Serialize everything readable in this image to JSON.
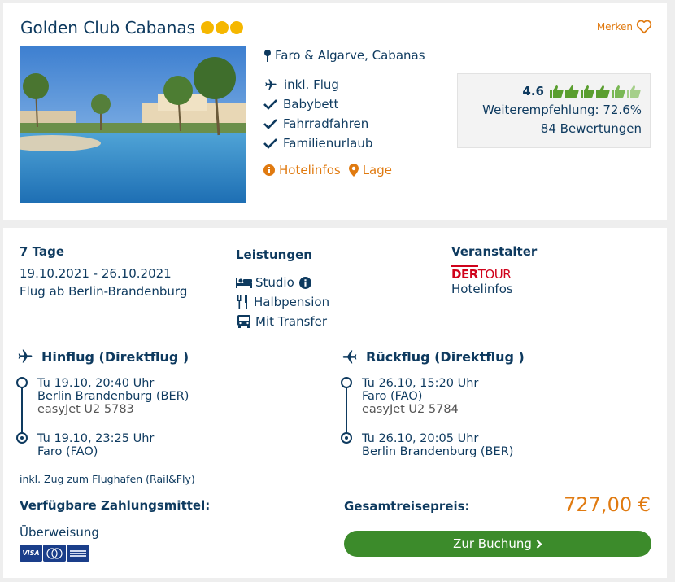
{
  "hotel": {
    "name": "Golden Club Cabanas",
    "stars": 3,
    "location": "Faro & Algarve, Cabanas",
    "features": [
      {
        "icon": "plane-icon",
        "label": "inkl. Flug"
      },
      {
        "icon": "check-icon",
        "label": "Babybett"
      },
      {
        "icon": "check-icon",
        "label": "Fahrradfahren"
      },
      {
        "icon": "check-icon",
        "label": "Familienurlaub"
      }
    ],
    "links": {
      "hotelinfos": "Hotelinfos",
      "lage": "Lage"
    }
  },
  "merken": {
    "label": "Merken",
    "icon": "heart-icon"
  },
  "rating": {
    "score": "4.6",
    "thumbs_out_of_6": 4.6,
    "recommendation": "Weiterempfehlung: 72.6%",
    "reviews": "84 Bewertungen"
  },
  "trip": {
    "duration": "7 Tage",
    "dates": "19.10.2021 - 26.10.2021",
    "departure": "Flug ab Berlin-Brandenburg"
  },
  "services": {
    "title": "Leistungen",
    "items": [
      {
        "icon": "bed-icon",
        "label": "Studio",
        "info": true
      },
      {
        "icon": "cutlery-icon",
        "label": "Halbpension"
      },
      {
        "icon": "bus-icon",
        "label": "Mit Transfer"
      }
    ]
  },
  "operator": {
    "title": "Veranstalter",
    "logo_der": "DER",
    "logo_tour": "TOUR",
    "link": "Hotelinfos"
  },
  "outbound": {
    "title": "Hinflug (Direktflug )",
    "dep_time": "Tu 19.10, 20:40 Uhr",
    "dep_airport": "Berlin Brandenburg (BER)",
    "carrier": "easyJet U2 5783",
    "arr_time": "Tu 19.10, 23:25 Uhr",
    "arr_airport": "Faro (FAO)"
  },
  "return": {
    "title": "Rückflug (Direktflug )",
    "dep_time": "Tu 26.10, 15:20 Uhr",
    "dep_airport": "Faro (FAO)",
    "carrier": "easyJet U2 5784",
    "arr_time": "Tu 26.10, 20:05 Uhr",
    "arr_airport": "Berlin Brandenburg (BER)"
  },
  "rail_note": "inkl. Zug zum Flughafen (Rail&Fly)",
  "payment": {
    "title": "Verfügbare Zahlungsmittel:",
    "method": "Überweisung",
    "visa": "VISA",
    "cards": [
      "visa",
      "mastercard",
      "american-express"
    ]
  },
  "total": {
    "label": "Gesamtreisepreis:",
    "price": "727,00 €"
  },
  "book": {
    "label": "Zur Buchung"
  },
  "colors": {
    "navy": "#0e3a5f",
    "orange": "#e07a10",
    "green": "#3c8b2b",
    "star": "#f5b700",
    "thumb": "#5a9e2f"
  }
}
